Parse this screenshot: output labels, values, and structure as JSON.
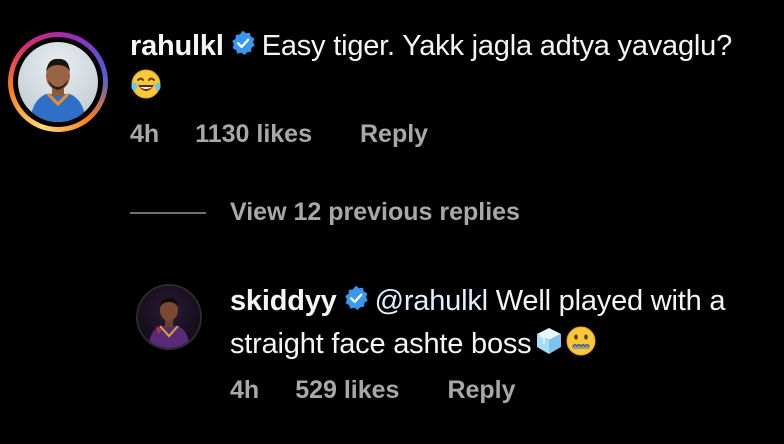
{
  "comments": [
    {
      "username": "rahulkl",
      "verified": true,
      "text": "Easy tiger. Yakk jagla adtya yavaglu?",
      "emoji": "laughing-tears-emoji",
      "time": "4h",
      "likes": "1130 likes",
      "reply_label": "Reply"
    }
  ],
  "view_replies": {
    "label": "View 12 previous replies"
  },
  "reply": {
    "username": "skiddyy",
    "verified": true,
    "mention": "@rahulkl",
    "text": "Well played with a straight face ashte boss",
    "emojis": [
      "ice-cube-emoji",
      "zipper-mouth-emoji"
    ],
    "time": "4h",
    "likes": "529 likes",
    "reply_label": "Reply"
  },
  "colors": {
    "background": "#000000",
    "text": "#f5f5f5",
    "meta": "#a8a8a8",
    "verified": "#3897f0"
  }
}
